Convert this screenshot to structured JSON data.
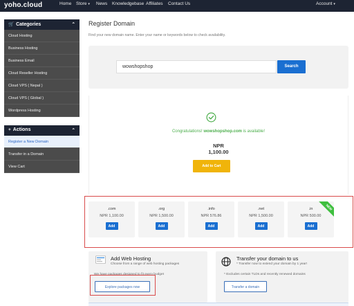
{
  "nav": {
    "logo": "yoho.cloud",
    "items": [
      "Home",
      "Store",
      "News",
      "Knowledgebase",
      "Affiliates",
      "Contact Us"
    ],
    "account": "Account"
  },
  "sidebar": {
    "categories_title": "Categories",
    "categories": [
      "Cloud Hosting",
      "Business Hosting",
      "Business Email",
      "Cloud Reseller Hosting",
      "Cloud VPS ( Nepal )",
      "Cloud VPS ( Global )",
      "Wordpress Hosting"
    ],
    "actions_title": "Actions",
    "actions": [
      "Register a New Domain",
      "Transfer in a Domain",
      "View Cart"
    ]
  },
  "main": {
    "title": "Register Domain",
    "subtitle": "Find your new domain name. Enter your name or keywords below to check availability.",
    "search_value": "wowshopshop",
    "search_button": "Search",
    "congrats_prefix": "Congratulations!",
    "congrats_domain": "wowshopshop.com",
    "congrats_suffix": "is available!",
    "price_currency": "NPR",
    "price_value": "1,100.00",
    "add_to_cart": "Add to Cart"
  },
  "suggestions": [
    {
      "tld": ".com",
      "price": "NPR 1,100.00",
      "add": "Add"
    },
    {
      "tld": ".org",
      "price": "NPR 1,500.00",
      "add": "Add"
    },
    {
      "tld": ".info",
      "price": "NPR 576.86",
      "add": "Add"
    },
    {
      "tld": ".net",
      "price": "NPR 1,500.00",
      "add": "Add"
    },
    {
      "tld": ".in",
      "price": "NPR 500.00",
      "add": "Add",
      "badge": "NEW"
    }
  ],
  "promos": {
    "hosting_title": "Add Web Hosting",
    "hosting_desc1": "Choose from a range of web hosting packages",
    "hosting_desc2": "We have packages designed to fit every budget",
    "hosting_button": "Explore packages now",
    "transfer_title": "Transfer your domain to us",
    "transfer_desc1": "* Transfer now to extend your domain by 1 year!",
    "transfer_desc2": "* Excludes certain TLDs and recently renewed domains",
    "transfer_button": "Transfer a domain"
  },
  "colors": {
    "nav_bg": "#1d2433",
    "primary": "#1a6fd1",
    "cart": "#f0b40a",
    "success": "#4cae4c",
    "highlight": "#d94b4b"
  }
}
